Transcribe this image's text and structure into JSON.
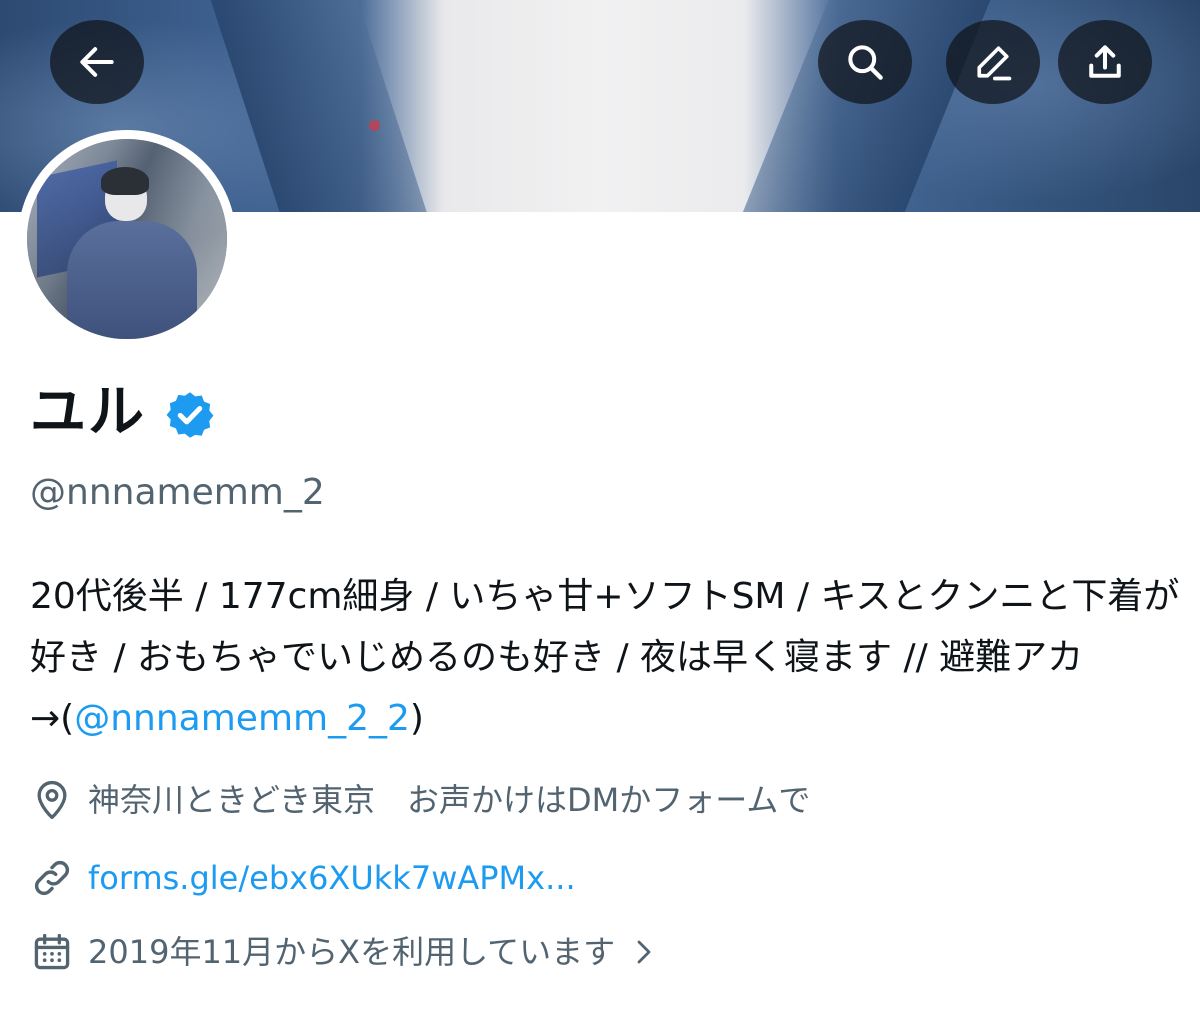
{
  "profile": {
    "display_name": "ユル",
    "verified_icon": "verified-badge-icon",
    "handle": "@nnnamemm_2",
    "bio_prefix": "20代後半 / 177cm細身 / いちゃ甘+ソフトSM / キスとクンニと下着が好き / おもちゃでいじめるのも好き / 夜は早く寝ます // 避難アカ →(",
    "bio_mention": "@nnnamemm_2_2",
    "bio_suffix": ")",
    "location": "神奈川ときどき東京　お声かけはDMかフォームで",
    "link": "forms.gle/ebx6XUkk7wAPMx...",
    "joined": "2019年11月からXを利用しています"
  },
  "header": {
    "back_icon": "arrow-left-icon",
    "search_icon": "search-icon",
    "edit_icon": "pencil-icon",
    "share_icon": "share-icon"
  },
  "colors": {
    "accent": "#1d9bf0",
    "secondary_text": "#536471",
    "primary_text": "#0f1419"
  }
}
